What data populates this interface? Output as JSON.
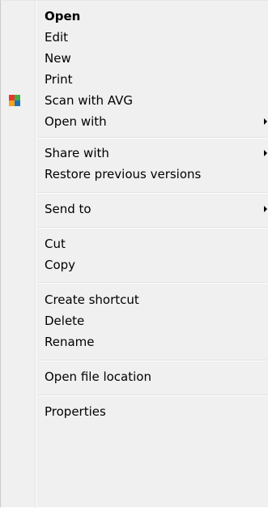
{
  "menu": {
    "items": [
      {
        "label": "Open",
        "bold": true,
        "submenu": false
      },
      {
        "label": "Edit",
        "bold": false,
        "submenu": false
      },
      {
        "label": "New",
        "bold": false,
        "submenu": false
      },
      {
        "label": "Print",
        "bold": false,
        "submenu": false
      },
      {
        "label": "Scan with AVG",
        "bold": false,
        "submenu": false,
        "icon": "avg-icon"
      },
      {
        "label": "Open with",
        "bold": false,
        "submenu": true
      },
      {
        "label": "Share with",
        "bold": false,
        "submenu": true
      },
      {
        "label": "Restore previous versions",
        "bold": false,
        "submenu": false
      },
      {
        "label": "Send to",
        "bold": false,
        "submenu": true
      },
      {
        "label": "Cut",
        "bold": false,
        "submenu": false
      },
      {
        "label": "Copy",
        "bold": false,
        "submenu": false
      },
      {
        "label": "Create shortcut",
        "bold": false,
        "submenu": false
      },
      {
        "label": "Delete",
        "bold": false,
        "submenu": false
      },
      {
        "label": "Rename",
        "bold": false,
        "submenu": false
      },
      {
        "label": "Open file location",
        "bold": false,
        "submenu": false
      },
      {
        "label": "Properties",
        "bold": false,
        "submenu": false
      }
    ]
  },
  "colors": {
    "menu_background": "#f0f0f0",
    "separator": "#e0e0e0",
    "avg_red": "#e8372b",
    "avg_green": "#3fae49",
    "avg_blue": "#1f6fb5",
    "avg_orange": "#f7a21b"
  }
}
